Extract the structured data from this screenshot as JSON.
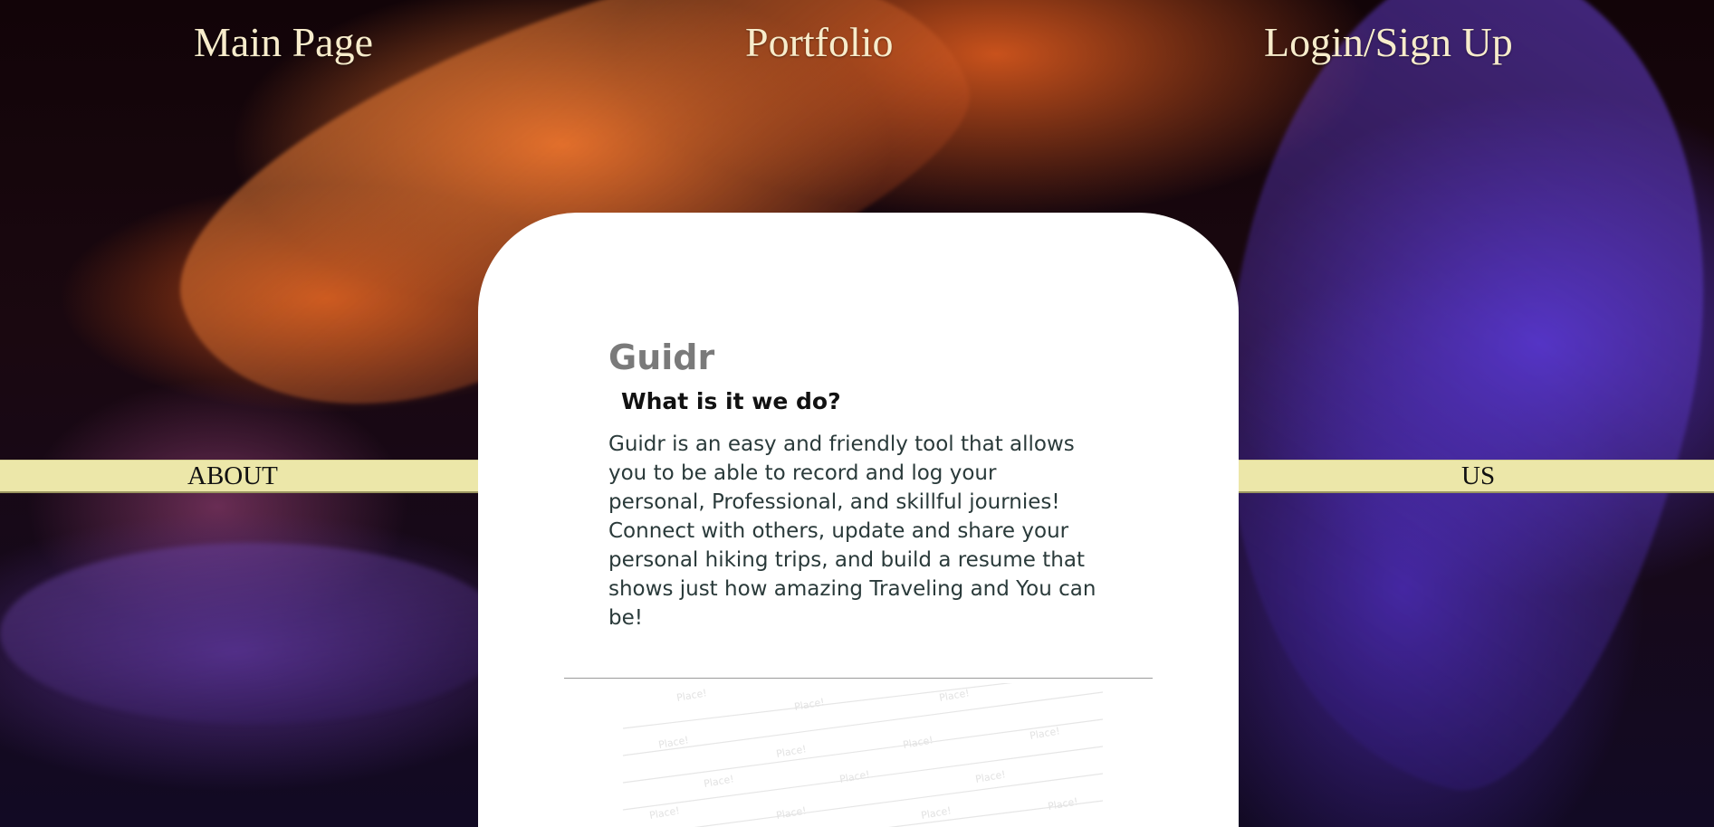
{
  "nav": {
    "main_page": "Main Page",
    "portfolio": "Portfolio",
    "login": "Login/Sign Up"
  },
  "side_bars": {
    "left_label": "ABOUT",
    "right_label": "US"
  },
  "card": {
    "title": "Guidr",
    "subtitle": "What is it we do?",
    "body": "Guidr is an easy and friendly tool that allows you to be able to record and log your personal, Professional, and skillful journies! Connect with others, update and share your personal hiking trips, and build a resume that shows just how amazing Traveling and You can be!"
  },
  "pattern": {
    "word": "Place!"
  },
  "colors": {
    "nav_text": "#f7eccb",
    "side_bar": "#ece7a9",
    "card_bg": "#ffffff",
    "title_gray": "#7a7a7a",
    "body_text": "#2a3a3a",
    "logo_gold": "#c7b732"
  }
}
